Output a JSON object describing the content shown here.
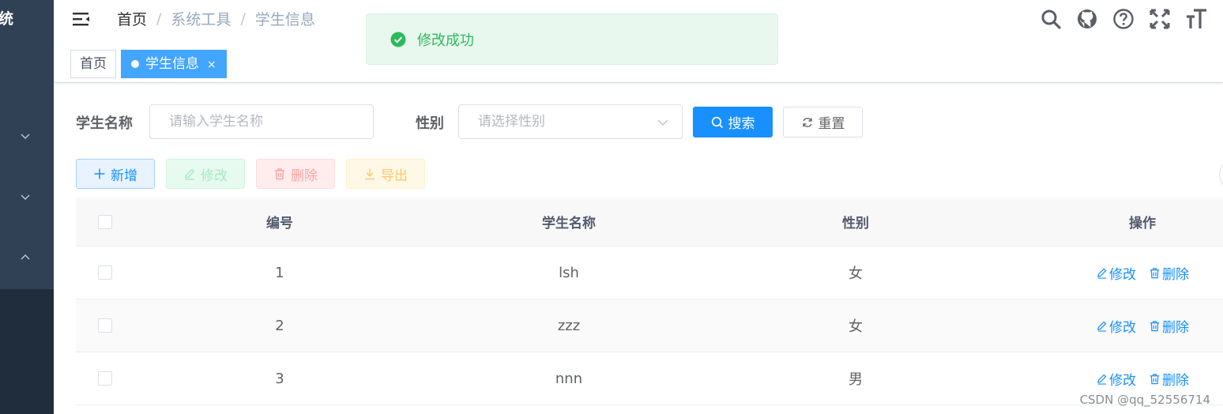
{
  "sidebar": {
    "brand_fragment": "统"
  },
  "breadcrumb": [
    "首页",
    "系统工具",
    "学生信息"
  ],
  "breadcrumb_separator": "/",
  "header_icons": [
    "search-icon",
    "github-icon",
    "question-icon",
    "fullscreen-icon",
    "font-size-icon"
  ],
  "message": {
    "text": "修改成功",
    "type": "success",
    "color": "#2bba5a"
  },
  "tags": {
    "home": "首页",
    "active": "学生信息",
    "close": "×"
  },
  "search": {
    "name_label": "学生名称",
    "name_placeholder": "请输入学生名称",
    "sex_label": "性别",
    "sex_placeholder": "请选择性别",
    "search_button": "搜索",
    "reset_button": "重置"
  },
  "toolbar": {
    "add": "新增",
    "edit": "修改",
    "delete": "删除",
    "export": "导出"
  },
  "table": {
    "columns": [
      "编号",
      "学生名称",
      "性别",
      "操作"
    ],
    "rows": [
      {
        "no": "1",
        "name": "lsh",
        "sex": "女"
      },
      {
        "no": "2",
        "name": "zzz",
        "sex": "女"
      },
      {
        "no": "3",
        "name": "nnn",
        "sex": "男"
      }
    ],
    "actions": {
      "edit": "修改",
      "delete": "删除"
    }
  },
  "colors": {
    "primary": "#1890ff",
    "sidebar": "#304156",
    "tag_active": "#42a5ff"
  },
  "watermark": "CSDN @qq_52556714"
}
